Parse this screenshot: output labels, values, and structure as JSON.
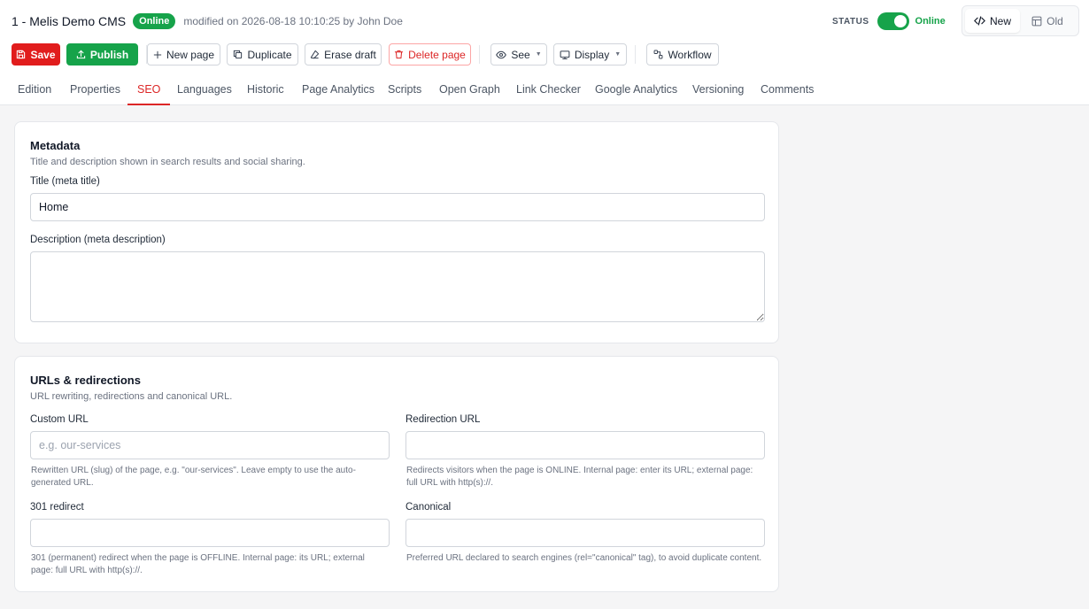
{
  "header": {
    "page_title": "1 - Melis Demo CMS",
    "online_badge": "Online",
    "modified": "modified on 2026-08-18 10:10:25 by John Doe",
    "status_label": "STATUS",
    "status_value": "Online",
    "status_on": true,
    "version_new": "New",
    "version_old": "Old"
  },
  "toolbar": {
    "save": "Save",
    "publish": "Publish",
    "new_page": "New page",
    "duplicate": "Duplicate",
    "erase_draft": "Erase draft",
    "delete_page": "Delete page",
    "see": "See",
    "display": "Display",
    "workflow": "Workflow"
  },
  "tabs": [
    "Edition",
    "Properties",
    "SEO",
    "Languages",
    "Historic",
    "Page Analytics",
    "Scripts",
    "Open Graph",
    "Link Checker",
    "Google Analytics",
    "Versioning",
    "Comments"
  ],
  "active_tab": "SEO",
  "metadata": {
    "title": "Metadata",
    "subtitle": "Title and description shown in search results and social sharing.",
    "meta_title_label": "Title (meta title)",
    "meta_title_value": "Home",
    "meta_desc_label": "Description (meta description)",
    "meta_desc_value": ""
  },
  "urls": {
    "title": "URLs & redirections",
    "subtitle": "URL rewriting, redirections and canonical URL.",
    "custom_url_label": "Custom URL",
    "custom_url_placeholder": "e.g. our-services",
    "custom_url_help": "Rewritten URL (slug) of the page, e.g. \"our-services\". Leave empty to use the auto-generated URL.",
    "redirection_label": "Redirection URL",
    "redirection_help": "Redirects visitors when the page is ONLINE. Internal page: enter its URL; external page: full URL with http(s)://.",
    "redirect301_label": "301 redirect",
    "redirect301_help": "301 (permanent) redirect when the page is OFFLINE. Internal page: its URL; external page: full URL with http(s)://.",
    "canonical_label": "Canonical",
    "canonical_help": "Preferred URL declared to search engines (rel=\"canonical\" tag), to avoid duplicate content."
  },
  "colors": {
    "accent": "#dc2626",
    "success": "#16a34a",
    "danger": "#e11d1d"
  },
  "icons": [
    "save-icon",
    "upload-icon",
    "plus-icon",
    "copy-icon",
    "eraser-icon",
    "trash-icon",
    "eye-icon",
    "monitor-icon",
    "workflow-icon",
    "code-icon",
    "layout-icon"
  ]
}
